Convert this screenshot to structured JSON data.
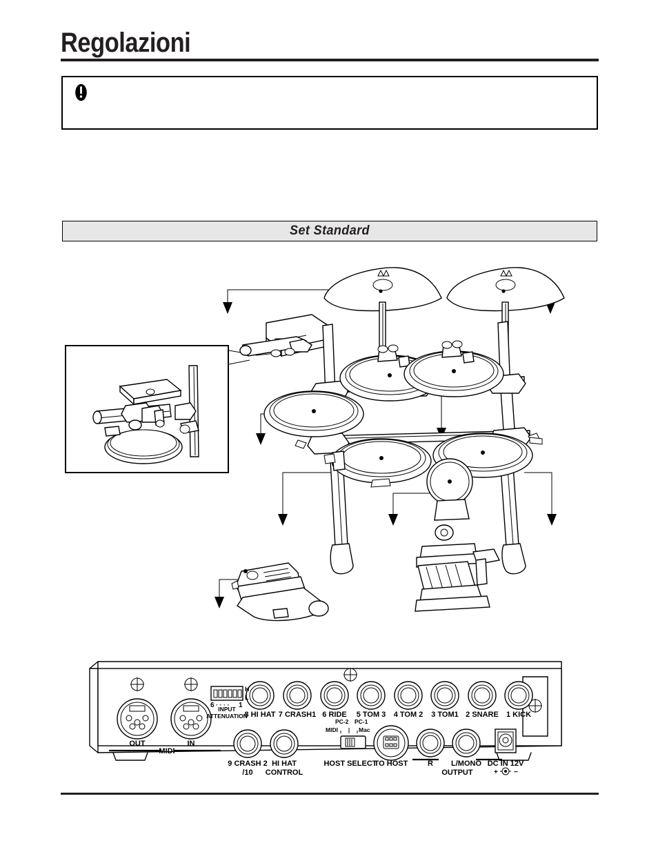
{
  "document": {
    "title": "Regolazioni",
    "language": "it"
  },
  "notice": {
    "icon": "exclamation-icon",
    "text": ""
  },
  "section": {
    "banner_label": "Set Standard"
  },
  "figure": {
    "caption": "",
    "detail_callout": {
      "label": "",
      "content": "clamp-detail-illustration"
    },
    "leader_arrows": 8
  },
  "rear_panel": {
    "midi": {
      "group_label": "MIDI",
      "out_label": "OUT",
      "in_label": "IN"
    },
    "attenuation": {
      "title_line1": "INPUT",
      "title_line2": "ATTENUATION",
      "high_label": "H",
      "low_label": "L",
      "scale_left": "6",
      "scale_dots": "·  ·  ·  ·",
      "scale_right": "1",
      "switch_count": 6
    },
    "trigger_jacks_row1": [
      {
        "number": "8",
        "name": "HI HAT"
      },
      {
        "number": "7",
        "name": "CRASH1"
      },
      {
        "number": "6",
        "name": "RIDE"
      },
      {
        "number": "5",
        "name": "TOM 3"
      },
      {
        "number": "4",
        "name": "TOM 2"
      },
      {
        "number": "3",
        "name": "TOM1"
      },
      {
        "number": "2",
        "name": "SNARE"
      },
      {
        "number": "1",
        "name": "KICK"
      }
    ],
    "trigger_jacks_row2": [
      {
        "line1": "9 CRASH 2",
        "line2": "/10"
      },
      {
        "line1": "HI HAT",
        "line2": "CONTROL"
      }
    ],
    "host_select": {
      "label": "HOST SELECT",
      "top_left": "PC-2",
      "top_right": "PC-1",
      "bottom_left": "MIDI",
      "bottom_right": "Mac"
    },
    "to_host": {
      "label": "TO HOST"
    },
    "output": {
      "group_label": "OUTPUT",
      "right_label": "R",
      "left_label": "L/MONO"
    },
    "power": {
      "label": "DC IN 12V",
      "polarity_left": "+",
      "polarity_right": "−"
    }
  },
  "footer": {
    "text": ""
  },
  "colors": {
    "ink": "#231f20",
    "banner_fill": "#e7e7e7",
    "paper": "#ffffff"
  }
}
